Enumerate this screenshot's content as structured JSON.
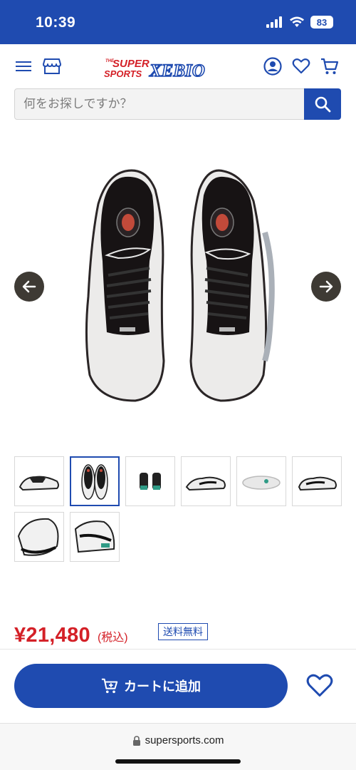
{
  "status_bar": {
    "time": "10:39",
    "battery": "83",
    "icons": [
      "signal-icon",
      "wifi-icon",
      "battery-icon"
    ],
    "background": "#1f4bb0"
  },
  "header": {
    "logo": {
      "line1": "THE",
      "line2": "SUPER",
      "line3": "SPORTS",
      "line4": "XEBIO"
    },
    "icons": [
      "menu-icon",
      "store-icon",
      "account-icon",
      "heart-icon",
      "cart-icon"
    ]
  },
  "search": {
    "placeholder": "何をお探しですか？",
    "button_icon": "search-icon"
  },
  "gallery": {
    "prev_icon": "arrow-left-icon",
    "next_icon": "arrow-right-icon",
    "thumbnail_count": 8,
    "selected_index": 1
  },
  "product": {
    "price": "¥21,480",
    "tax_note": "(税込)",
    "shipping_badge": "送料無料"
  },
  "cart": {
    "label": "カートに追加",
    "icon": "cart-icon"
  },
  "browser": {
    "url": "supersports.com",
    "lock_icon": "lock-icon"
  },
  "colors": {
    "brand_blue": "#1f4bb0",
    "price_red": "#d42027",
    "arrow_bg": "#3e3a34"
  }
}
